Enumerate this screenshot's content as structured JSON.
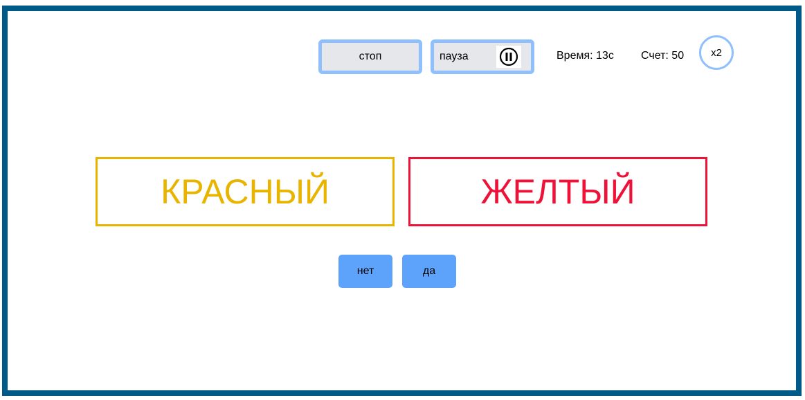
{
  "controls": {
    "stop_label": "стоп",
    "pause_label": "пауза"
  },
  "stats": {
    "time": "Время: 13с",
    "score": "Счет: 50",
    "multiplier": "x2"
  },
  "cards": {
    "meaning": {
      "word": "КРАСНЫЙ",
      "color": "#e8b400"
    },
    "ink": {
      "word": "ЖЕЛТЫЙ",
      "color": "#ee1138"
    }
  },
  "answers": {
    "no_label": "нет",
    "yes_label": "да"
  },
  "colors": {
    "frame": "#005a87",
    "button_border": "#8fc0fb",
    "answer_button": "#5ea3fb"
  }
}
